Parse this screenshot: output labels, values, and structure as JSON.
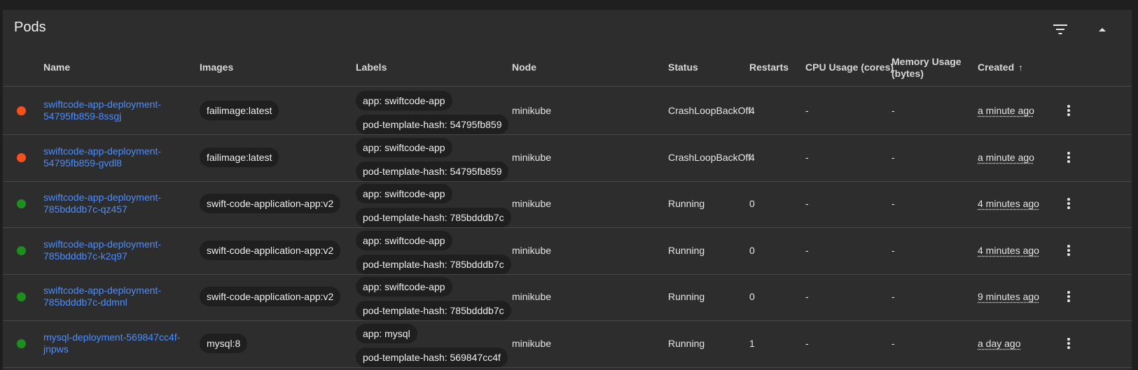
{
  "title": "Pods",
  "icons": {
    "filter": "filter-list-icon",
    "collapse": "expand-less-icon",
    "menu": "more-vert-icon"
  },
  "colors": {
    "error": "#f4511e",
    "ok": "#1e8e1e",
    "link": "#4c8dff"
  },
  "columns": {
    "name": "Name",
    "images": "Images",
    "labels": "Labels",
    "node": "Node",
    "status": "Status",
    "restarts": "Restarts",
    "cpu": "CPU Usage (cores)",
    "memory": "Memory Usage (bytes)",
    "created": "Created",
    "created_sort": "↑"
  },
  "rows": [
    {
      "state": "error",
      "name": "swiftcode-app-deployment-54795fb859-8ssgj",
      "image": "failimage:latest",
      "label1": "app: swiftcode-app",
      "label2": "pod-template-hash: 54795fb859",
      "node": "minikube",
      "status": "CrashLoopBackOff",
      "restarts": "4",
      "cpu": "-",
      "memory": "-",
      "created": "a minute ago"
    },
    {
      "state": "error",
      "name": "swiftcode-app-deployment-54795fb859-gvdl8",
      "image": "failimage:latest",
      "label1": "app: swiftcode-app",
      "label2": "pod-template-hash: 54795fb859",
      "node": "minikube",
      "status": "CrashLoopBackOff",
      "restarts": "4",
      "cpu": "-",
      "memory": "-",
      "created": "a minute ago"
    },
    {
      "state": "ok",
      "name": "swiftcode-app-deployment-785bdddb7c-qz457",
      "image": "swift-code-application-app:v2",
      "label1": "app: swiftcode-app",
      "label2": "pod-template-hash: 785bdddb7c",
      "node": "minikube",
      "status": "Running",
      "restarts": "0",
      "cpu": "-",
      "memory": "-",
      "created": "4 minutes ago"
    },
    {
      "state": "ok",
      "name": "swiftcode-app-deployment-785bdddb7c-k2q97",
      "image": "swift-code-application-app:v2",
      "label1": "app: swiftcode-app",
      "label2": "pod-template-hash: 785bdddb7c",
      "node": "minikube",
      "status": "Running",
      "restarts": "0",
      "cpu": "-",
      "memory": "-",
      "created": "4 minutes ago"
    },
    {
      "state": "ok",
      "name": "swiftcode-app-deployment-785bdddb7c-ddmnl",
      "image": "swift-code-application-app:v2",
      "label1": "app: swiftcode-app",
      "label2": "pod-template-hash: 785bdddb7c",
      "node": "minikube",
      "status": "Running",
      "restarts": "0",
      "cpu": "-",
      "memory": "-",
      "created": "9 minutes ago"
    },
    {
      "state": "ok",
      "name": "mysql-deployment-569847cc4f-jnpws",
      "image": "mysql:8",
      "label1": "app: mysql",
      "label2": "pod-template-hash: 569847cc4f",
      "node": "minikube",
      "status": "Running",
      "restarts": "1",
      "cpu": "-",
      "memory": "-",
      "created": "a day ago"
    }
  ]
}
